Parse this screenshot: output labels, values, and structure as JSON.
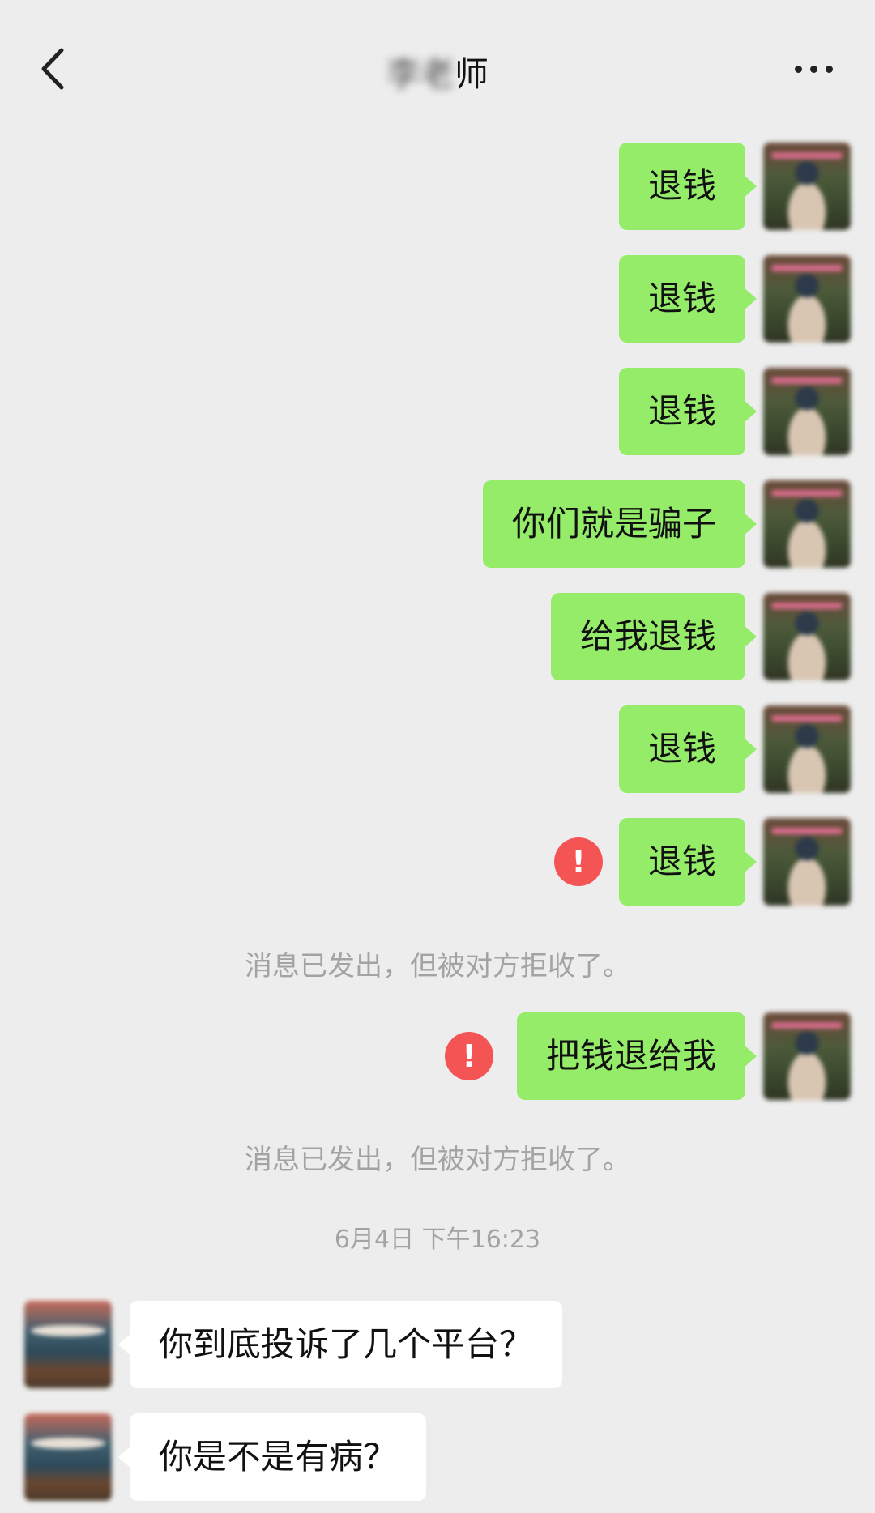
{
  "header": {
    "title_blurred": "李老",
    "title_suffix": "师"
  },
  "messages_sent": [
    {
      "text": "退钱"
    },
    {
      "text": "退钱"
    },
    {
      "text": "退钱"
    },
    {
      "text": "你们就是骗子"
    },
    {
      "text": "给我退钱"
    },
    {
      "text": "退钱"
    },
    {
      "text": "退钱"
    },
    {
      "text": "把钱退给我"
    }
  ],
  "error_icon_symbol": "!",
  "system_notes": [
    "消息已发出，但被对方拒收了。",
    "消息已发出，但被对方拒收了。"
  ],
  "timestamp": "6月4日 下午16:23",
  "messages_received": [
    {
      "text": "你到底投诉了几个平台？"
    },
    {
      "text": "你是不是有病？"
    }
  ],
  "colors": {
    "background": "#ededed",
    "sent_bubble": "#95ec69",
    "received_bubble": "#ffffff",
    "error": "#f45454",
    "system_text": "#a3a3a3"
  }
}
